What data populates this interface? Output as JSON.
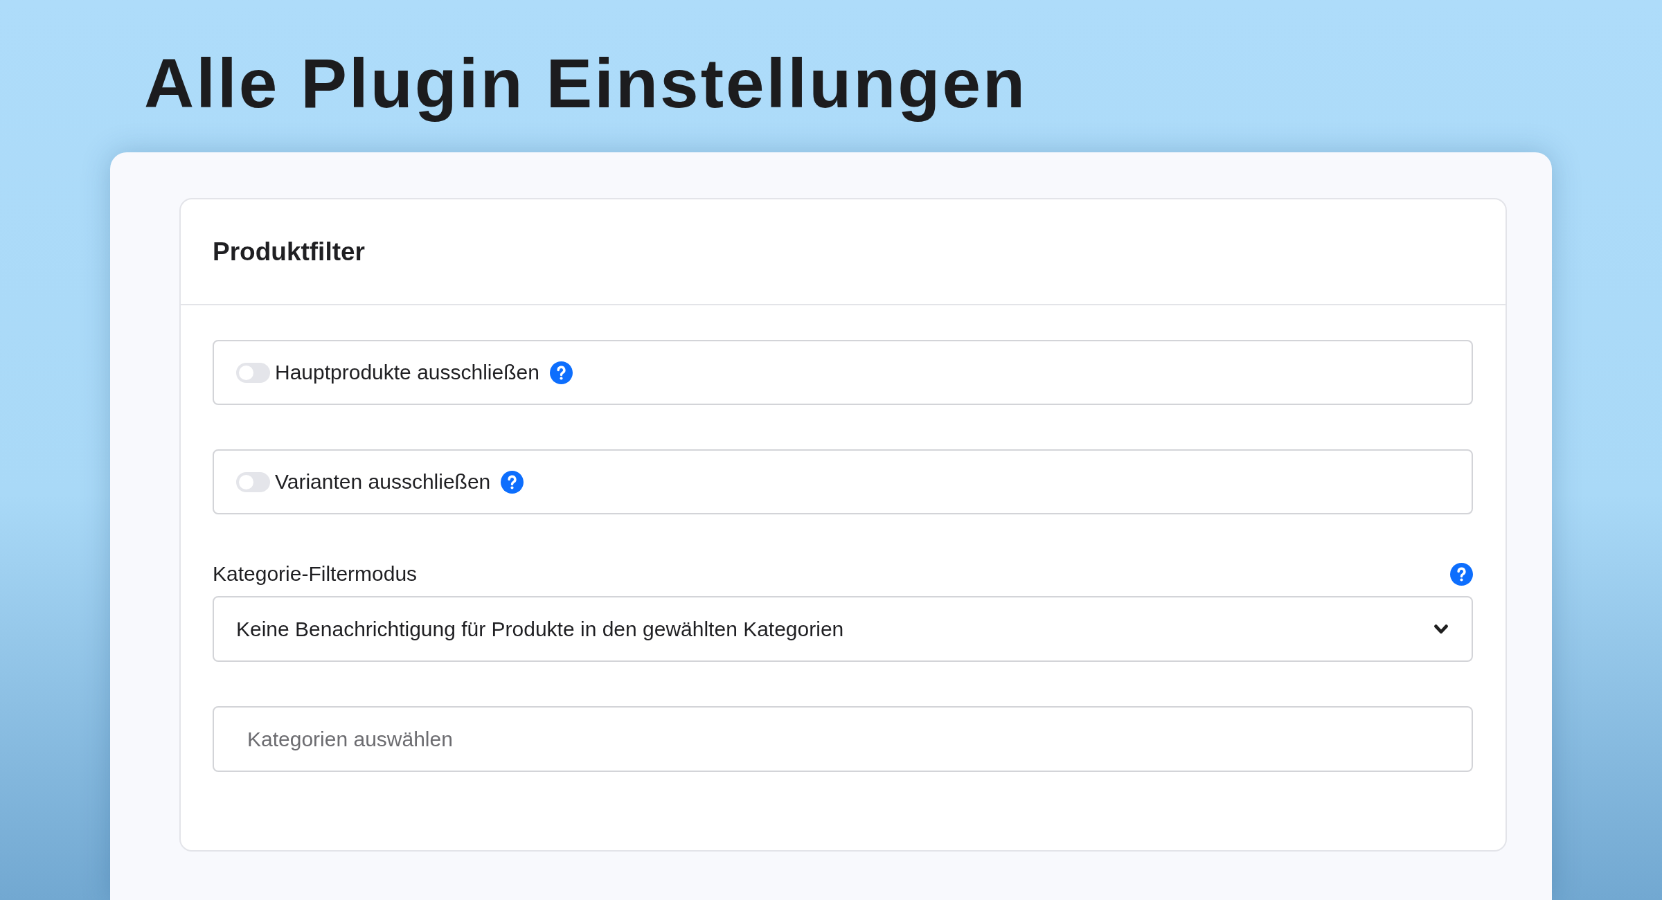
{
  "page_title": "Alle Plugin Einstellungen",
  "panel": {
    "title": "Produktfilter",
    "fields": [
      {
        "kind": "toggle",
        "label": "Hauptprodukte ausschließen",
        "on": false,
        "help": true
      },
      {
        "kind": "toggle",
        "label": "Varianten ausschließen",
        "on": false,
        "help": true
      },
      {
        "kind": "select",
        "label": "Kategorie-Filtermodus",
        "value": "Keine Benachrichtigung für Produkte in den gewählten Kategorien",
        "help": true
      },
      {
        "kind": "input",
        "placeholder": "Kategorien auswählen"
      }
    ]
  }
}
